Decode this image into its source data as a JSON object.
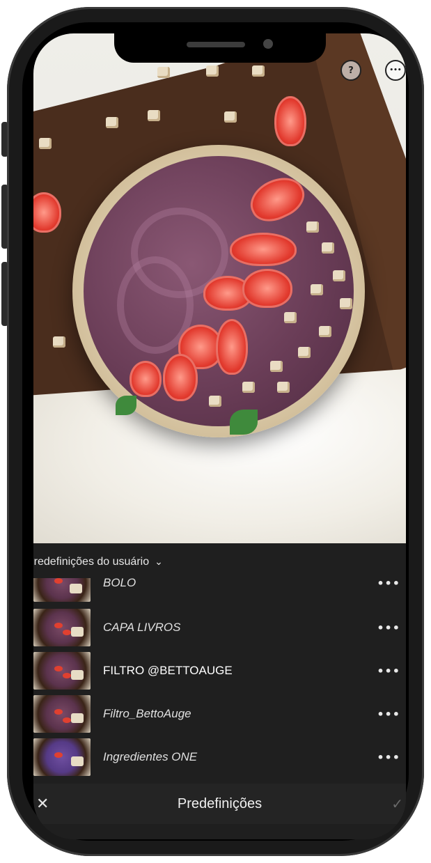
{
  "toolbar": {
    "help_icon": "?",
    "more_icon": "•••"
  },
  "presets": {
    "group_label": "Predefinições do usuário",
    "chevron": "⌄",
    "items": [
      {
        "label": "BOLO",
        "menu": "•••"
      },
      {
        "label": "CAPA LIVROS",
        "menu": "•••"
      },
      {
        "label": "FILTRO @BETTOAUGE",
        "menu": "•••"
      },
      {
        "label": "Filtro_BettoAuge",
        "menu": "•••"
      },
      {
        "label": "Ingredientes ONE",
        "menu": "•••"
      }
    ]
  },
  "bottom": {
    "close": "✕",
    "title": "Predefinições",
    "confirm": "✓"
  }
}
